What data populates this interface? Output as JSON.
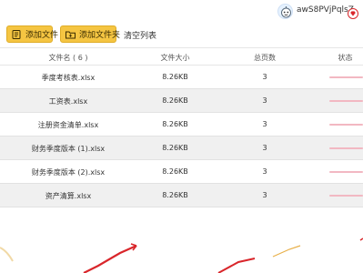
{
  "user": {
    "name": "awS8PVjPqlsZ",
    "avatar_icon": "robot-avatar-icon",
    "vip_icon": "vip-diamond-icon"
  },
  "toolbar": {
    "add_file": "添加文件",
    "add_folder": "添加文件夹",
    "clear_list": "清空列表"
  },
  "table": {
    "headers": {
      "name": "文件名 ( 6 )",
      "size": "文件大小",
      "pages": "总页数",
      "status": "状态"
    },
    "rows": [
      {
        "name": "季度考核表.xlsx",
        "size": "8.26KB",
        "pages": "3"
      },
      {
        "name": "工资表.xlsx",
        "size": "8.26KB",
        "pages": "3"
      },
      {
        "name": "注册资金清单.xlsx",
        "size": "8.26KB",
        "pages": "3"
      },
      {
        "name": "财务季度版本 (1).xlsx",
        "size": "8.26KB",
        "pages": "3"
      },
      {
        "name": "财务季度版本 (2).xlsx",
        "size": "8.26KB",
        "pages": "3"
      },
      {
        "name": "资产清算.xlsx",
        "size": "8.26KB",
        "pages": "3"
      }
    ]
  },
  "colors": {
    "accent": "#f5c542",
    "row_alt": "#f0f0f0",
    "status_line": "#f2b8c2",
    "decor_red": "#d9262b"
  }
}
